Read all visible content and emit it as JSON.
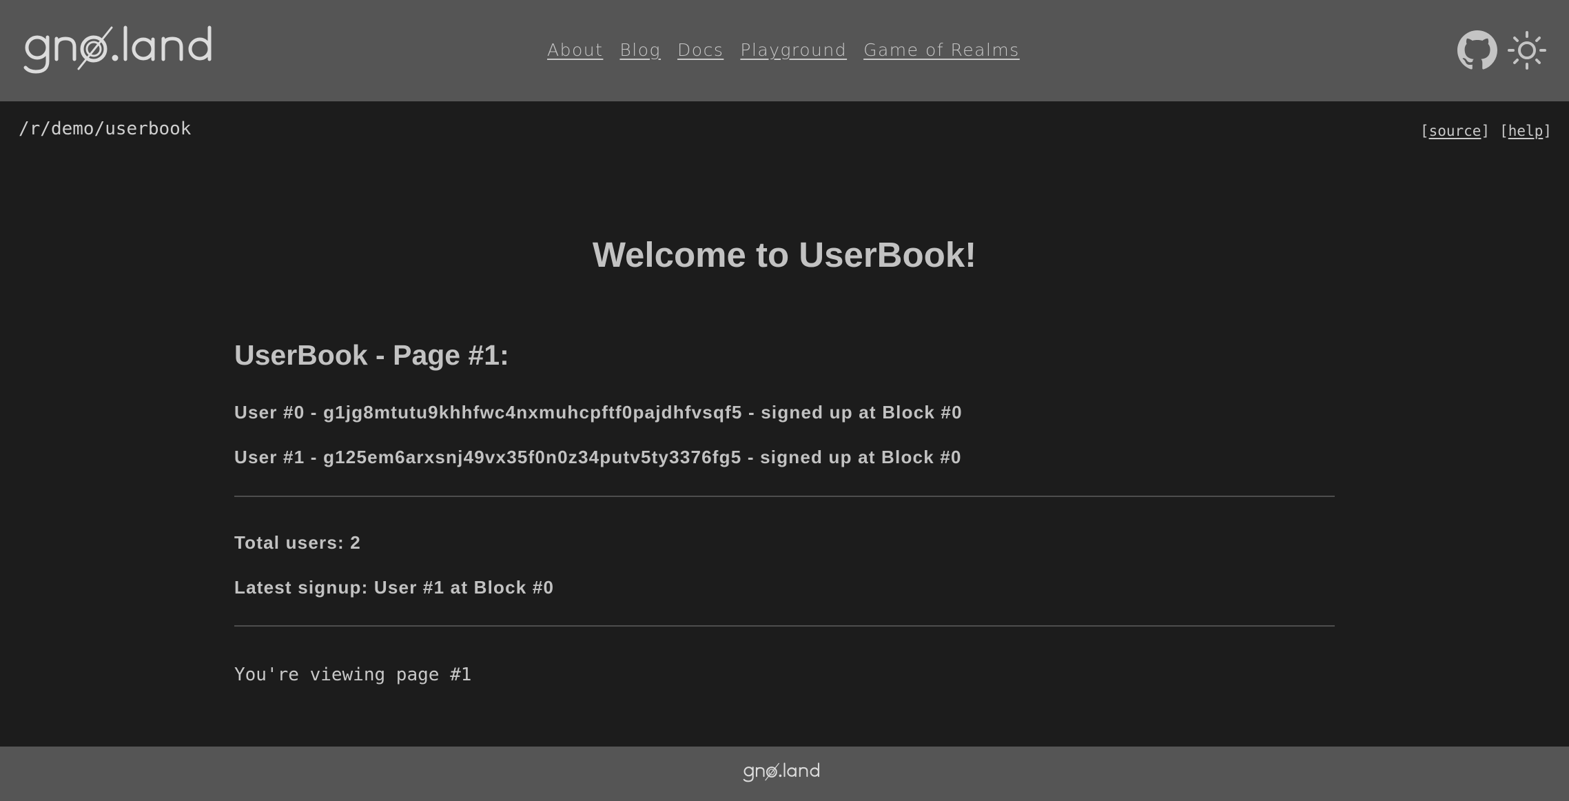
{
  "header": {
    "logo_text": "gnø.land",
    "nav": [
      {
        "label": "About"
      },
      {
        "label": "Blog"
      },
      {
        "label": "Docs"
      },
      {
        "label": "Playground"
      },
      {
        "label": "Game of Realms"
      }
    ],
    "icons": [
      "github-icon",
      "sun-icon"
    ]
  },
  "subheader": {
    "path": "/r/demo/userbook",
    "links": [
      {
        "label": "source"
      },
      {
        "label": "help"
      }
    ]
  },
  "main": {
    "title": "Welcome to UserBook!",
    "page_heading": "UserBook - Page #1:",
    "users": [
      {
        "text": "User #0 - g1jg8mtutu9khhfwc4nxmuhcpftf0pajdhfvsqf5 - signed up at Block #0"
      },
      {
        "text": "User #1 - g125em6arxsnj49vx35f0n0z34putv5ty3376fg5 - signed up at Block #0"
      }
    ],
    "total_users": "Total users: 2",
    "latest_signup": "Latest signup: User #1 at Block #0",
    "viewing": "You're viewing page #1"
  },
  "footer": {
    "logo_text": "gnø.land"
  },
  "colors": {
    "header_bg": "#555555",
    "body_bg": "#1c1c1c",
    "text": "#c2c2c2"
  }
}
